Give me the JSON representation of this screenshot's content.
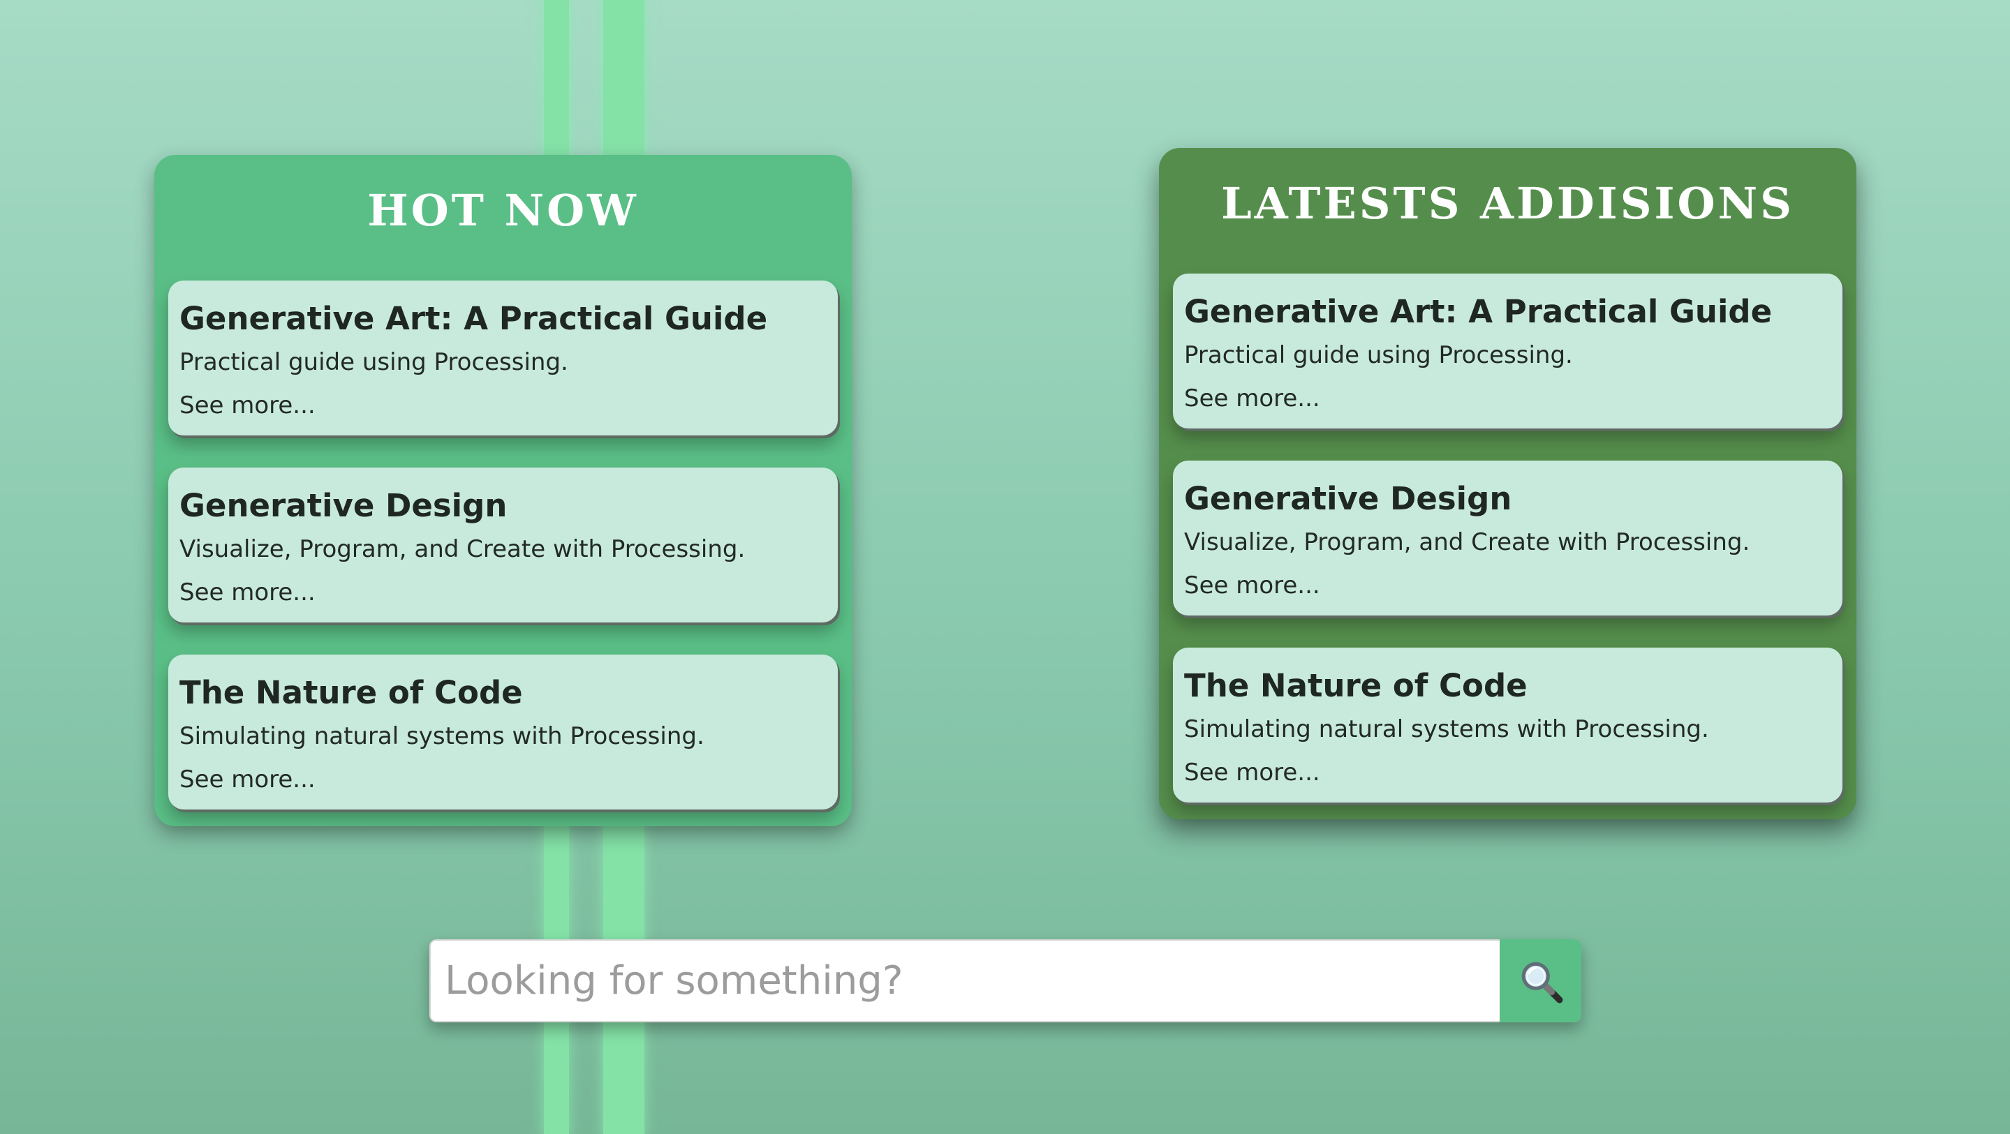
{
  "hot_now": {
    "title": "HOT NOW",
    "books": [
      {
        "title": "Generative Art: A Practical Guide",
        "description": "Practical guide using Processing.",
        "link": "See more..."
      },
      {
        "title": "Generative Design",
        "description": "Visualize, Program, and Create with Processing.",
        "link": "See more..."
      },
      {
        "title": "The Nature of Code",
        "description": "Simulating natural systems with Processing.",
        "link": "See more..."
      }
    ]
  },
  "latest": {
    "title": "LATESTS ADDISIONS",
    "books": [
      {
        "title": "Generative Art: A Practical Guide",
        "description": "Practical guide using Processing.",
        "link": "See more..."
      },
      {
        "title": "Generative Design",
        "description": "Visualize, Program, and Create with Processing.",
        "link": "See more..."
      },
      {
        "title": "The Nature of Code",
        "description": "Simulating natural systems with Processing.",
        "link": "See more..."
      }
    ]
  },
  "search": {
    "placeholder": "Looking for something?",
    "value": "",
    "button_icon": "magnifying-glass-icon"
  },
  "colors": {
    "background": "#8ccbb0",
    "stripe": "#84e2a7",
    "hot_panel": "#5abf86",
    "latest_panel": "#558e4c",
    "card": "#c8eadc",
    "search_button": "#5abf86"
  }
}
